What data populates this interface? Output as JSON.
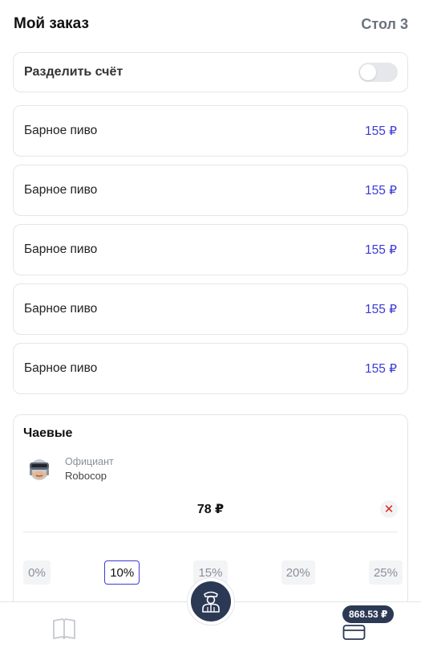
{
  "header": {
    "title": "Мой заказ",
    "table": "Стол 3"
  },
  "split_bill": {
    "label": "Разделить счёт",
    "enabled": false
  },
  "items": [
    {
      "name": "Барное пиво",
      "price": "155 ₽"
    },
    {
      "name": "Барное пиво",
      "price": "155 ₽"
    },
    {
      "name": "Барное пиво",
      "price": "155 ₽"
    },
    {
      "name": "Барное пиво",
      "price": "155 ₽"
    },
    {
      "name": "Барное пиво",
      "price": "155 ₽"
    }
  ],
  "tips": {
    "title": "Чаевые",
    "waiter_role": "Официант",
    "waiter_name": "Robocop",
    "amount": "78 ₽",
    "options": [
      "0%",
      "10%",
      "15%",
      "20%",
      "25%"
    ],
    "selected_option": "10%"
  },
  "bottom_bar": {
    "cart_total": "868.53 ₽"
  },
  "colors": {
    "accent": "#3b3bd6",
    "dark": "#2b3955",
    "muted": "#6b7280",
    "danger": "#e02424"
  },
  "icons": [
    "book-icon",
    "waiter-icon",
    "card-icon",
    "close-icon",
    "avatar-robocop"
  ]
}
